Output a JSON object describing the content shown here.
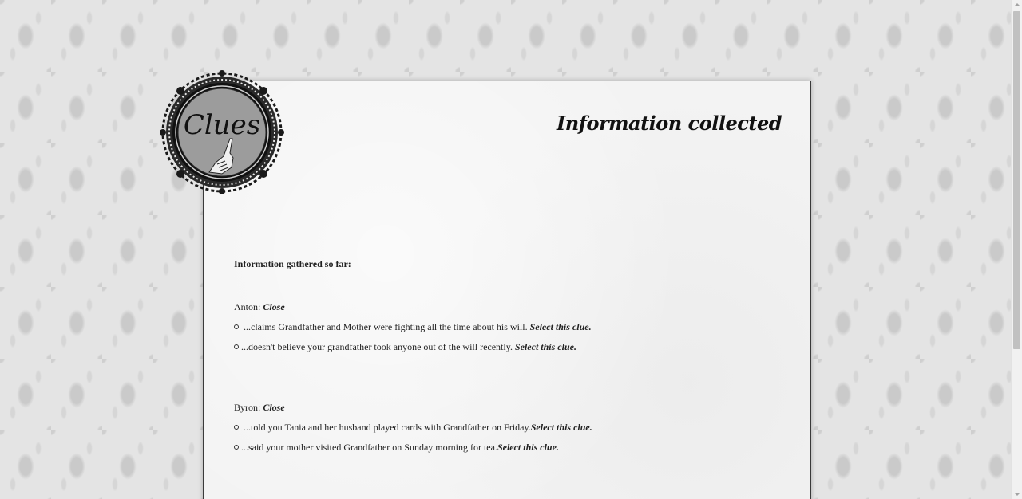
{
  "badge": {
    "label": "Clues"
  },
  "panel": {
    "title": "Information collected",
    "intro": "Information gathered so far:"
  },
  "characters": [
    {
      "name_prefix": "Anton: ",
      "close_label": "Close",
      "clues": [
        {
          "text": " ...claims Grandfather and Mother were fighting all the time about his will. ",
          "select_label": "Select this clue."
        },
        {
          "text": "...doesn't believe your grandfather took anyone out of the will recently. ",
          "select_label": "Select this clue."
        }
      ]
    },
    {
      "name_prefix": "Byron: ",
      "close_label": "Close",
      "clues": [
        {
          "text": " ...told you Tania and her husband played cards with Grandfather on Friday.",
          "select_label": "Select this clue."
        },
        {
          "text": "...said your mother visited Grandfather on Sunday morning for tea.",
          "select_label": "Select this clue."
        }
      ]
    }
  ]
}
